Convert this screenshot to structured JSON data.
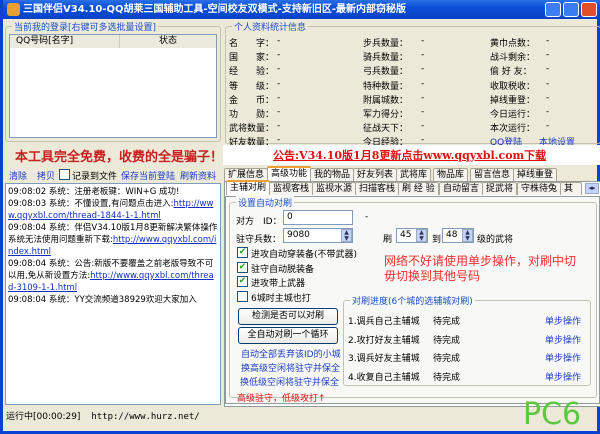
{
  "window": {
    "title": "三国伴侣V34.10-QQ胡莱三国辅助工具-空间校友双模式-支持新旧区-最新内部窃秘版"
  },
  "accounts": {
    "group_title": "当前我的登录[右键可多选批量设置]",
    "columns": [
      "QQ号码[名字]",
      "状态"
    ],
    "slogan": "本工具完全免费，收费的全是骗子！"
  },
  "log_toolbar": {
    "clear": "清除",
    "copy": "拷贝",
    "record_to_file": "记录到文件",
    "record_checked": false,
    "save_login": "保存当前登陆",
    "refresh": "刷新资料"
  },
  "log": [
    {
      "text": "09:08:02 系统：注册老板键：WIN+G 成功!",
      "link": ""
    },
    {
      "text": "09:08:03 系统：不懂设置,有问题点击进入:",
      "link": "http://www.qqyxbl.com/thread-1844-1-1.html"
    },
    {
      "text": "09:08:04 系统：伴侣V34.10版1月8更新解决繁体操作系统无法使用问题重新下载:",
      "link": "http://www.qqyxbl.com/index.html"
    },
    {
      "text": "09:08:04 系统：公告:新版不要覆盖之前老版导致不可以用,免从新设置方法:",
      "link": "http://www.qqyxbl.com/thread-3109-1-1.html"
    },
    {
      "text": "09:08:04 系统：YY交流频道38929欢迎大家加入",
      "link": ""
    }
  ],
  "status_bar": {
    "running": "运行中[00:00:29]",
    "url": "http://www.hurz.net/"
  },
  "stats": {
    "group_title": "个人资料统计信息",
    "col1": [
      {
        "label": "名　　字：",
        "value": "-"
      },
      {
        "label": "国　　家：",
        "value": "-"
      },
      {
        "label": "经　　验：",
        "value": "-"
      },
      {
        "label": "等　　级：",
        "value": "-"
      },
      {
        "label": "金　　币：",
        "value": "-"
      },
      {
        "label": "功　　勋：",
        "value": "-"
      },
      {
        "label": "武将数量：",
        "value": "-"
      },
      {
        "label": "好友数量：",
        "value": "-"
      }
    ],
    "col2": [
      {
        "label": "步兵数量：",
        "value": "-"
      },
      {
        "label": "骑兵数量：",
        "value": "-"
      },
      {
        "label": "弓兵数量：",
        "value": "-"
      },
      {
        "label": "特种数量：",
        "value": "-"
      },
      {
        "label": "附属城数：",
        "value": "-"
      },
      {
        "label": "军力得分：",
        "value": "-"
      },
      {
        "label": "征战天下：",
        "value": "-"
      },
      {
        "label": "今日经验：",
        "value": "-"
      }
    ],
    "col3": [
      {
        "label": "黄巾点数：",
        "value": "-"
      },
      {
        "label": "战斗剩余：",
        "value": "-"
      },
      {
        "label": "偷 好 友：",
        "value": "-"
      },
      {
        "label": "收取税收：",
        "value": "-"
      },
      {
        "label": "掉线重登：",
        "value": "-"
      },
      {
        "label": "今日运行：",
        "value": "-"
      },
      {
        "label": "本次运行：",
        "value": "-"
      }
    ],
    "qq_login": "QQ登陆",
    "local_settings": "本地设置"
  },
  "announcement": "公告:V34.10版1月8更新点击www.qqyxbl.com下载",
  "tabs1": [
    "扩展信息",
    "高级功能",
    "我的物品",
    "好友列表",
    "武将库",
    "物品库",
    "留言信息",
    "掉线重登"
  ],
  "tabs1_active": 1,
  "tabs2": [
    "主辅对刷",
    "监视客栈",
    "监视水源",
    "扫描客栈",
    "刷 经 验",
    "自动留言",
    "捉武将",
    "守株待兔",
    "其他"
  ],
  "tabs2_active": 0,
  "auto": {
    "group_title": "设置自动对刷",
    "opponent_label": "对方　ID：",
    "opponent_value": "0",
    "dash": "-",
    "garrison_label": "驻守兵数：",
    "garrison_value": "9080",
    "brush_label": "刷",
    "from_value": "45",
    "to_label": "到",
    "to_value": "48",
    "level_suffix": "级的武将",
    "checks": [
      {
        "label": "进攻自动穿装备(不带武器)",
        "checked": true
      },
      {
        "label": "驻守自动脱装备",
        "checked": true
      },
      {
        "label": "进攻带上武器",
        "checked": true
      },
      {
        "label": "6城时主城也打",
        "checked": false
      }
    ],
    "warning": "网络不好请使用单步操作，对刷中切毋切换到其他号码",
    "check_btn": "检测是否可以对刷",
    "auto_btn": "全自动对刷一个循环",
    "links": [
      "自动全部丢弃该ID的小城",
      "换高级空闲将驻守并保全",
      "换低级空闲将驻守并保全"
    ],
    "note": "高级驻守，低级攻打↑",
    "progress_title": "对刷进度(6个城的选辅城对刷)",
    "steps": [
      {
        "name": "1.调兵自己主辅城",
        "status": "待完成",
        "action": "单步操作"
      },
      {
        "name": "2.攻打好友主辅城",
        "status": "待完成",
        "action": "单步操作"
      },
      {
        "name": "3.调兵好友主辅城",
        "status": "待完成",
        "action": "单步操作"
      },
      {
        "name": "4.收复自己主辅城",
        "status": "待完成",
        "action": "单步操作"
      }
    ]
  },
  "watermark": "PC6下载.com",
  "colors": {
    "title_bar": "#0a4fd6",
    "accent_red": "#e01010",
    "link_blue": "#1a3cc8"
  }
}
